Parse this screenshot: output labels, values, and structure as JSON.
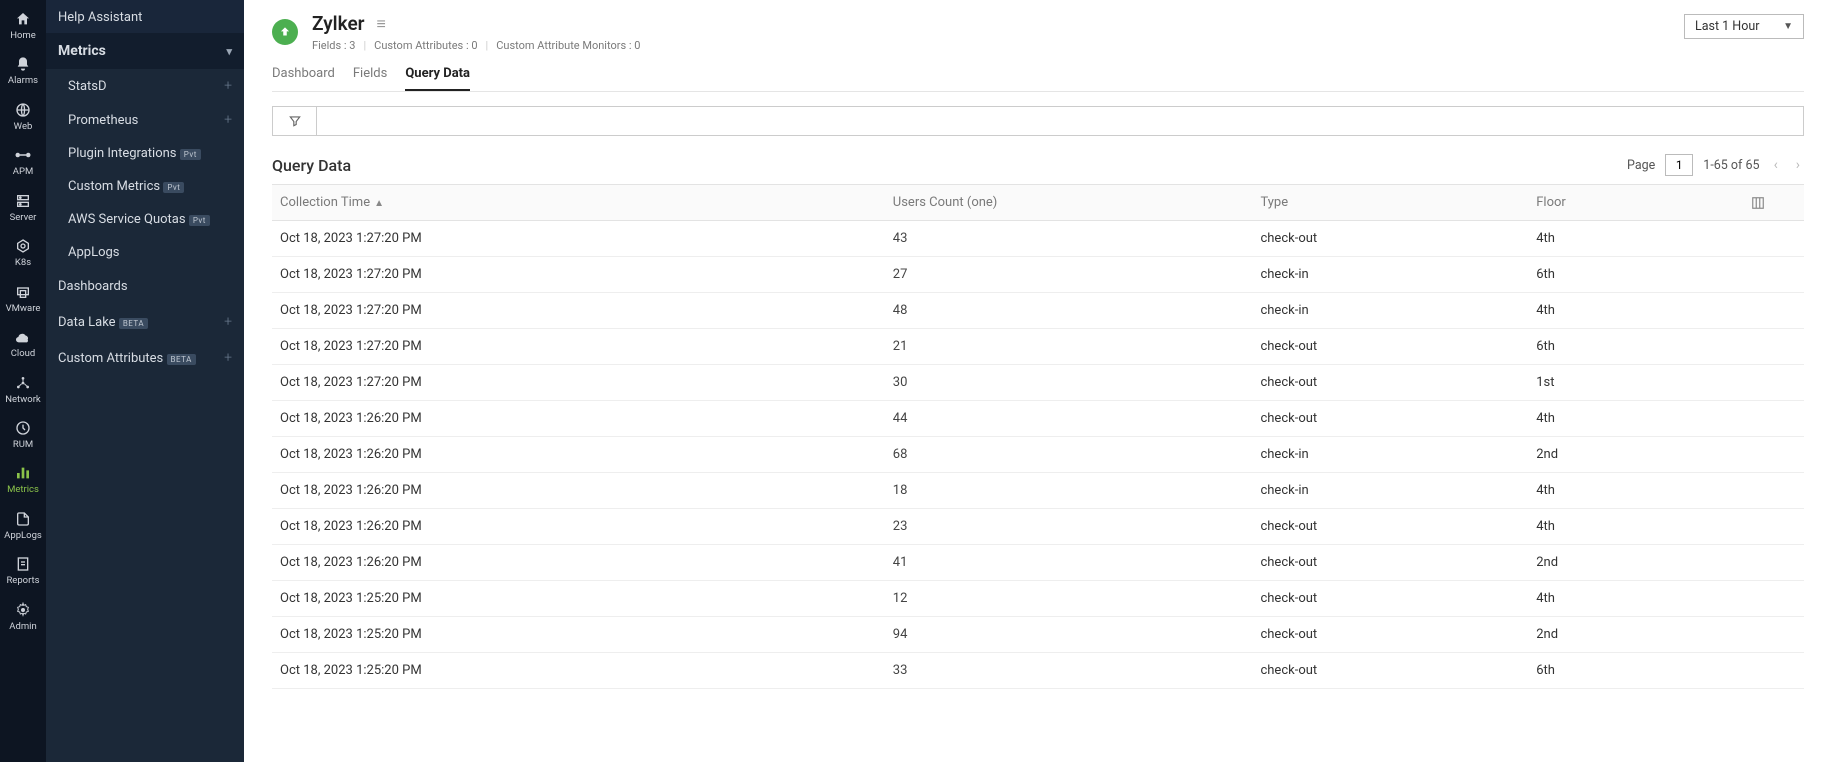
{
  "rail": [
    {
      "key": "home",
      "label": "Home"
    },
    {
      "key": "alarms",
      "label": "Alarms"
    },
    {
      "key": "web",
      "label": "Web"
    },
    {
      "key": "apm",
      "label": "APM"
    },
    {
      "key": "server",
      "label": "Server"
    },
    {
      "key": "k8s",
      "label": "K8s"
    },
    {
      "key": "vmware",
      "label": "VMware"
    },
    {
      "key": "cloud",
      "label": "Cloud"
    },
    {
      "key": "network",
      "label": "Network"
    },
    {
      "key": "rum",
      "label": "RUM"
    },
    {
      "key": "metrics",
      "label": "Metrics",
      "active": true
    },
    {
      "key": "applogs",
      "label": "AppLogs"
    },
    {
      "key": "reports",
      "label": "Reports"
    },
    {
      "key": "admin",
      "label": "Admin"
    }
  ],
  "sidebar": {
    "help": "Help Assistant",
    "section": "Metrics",
    "sub": [
      {
        "label": "StatsD",
        "plus": true
      },
      {
        "label": "Prometheus",
        "plus": true
      },
      {
        "label": "Plugin Integrations",
        "badge": "Pvt"
      },
      {
        "label": "Custom Metrics",
        "badge": "Pvt"
      },
      {
        "label": "AWS Service Quotas",
        "badge": "Pvt"
      },
      {
        "label": "AppLogs"
      }
    ],
    "items": [
      {
        "label": "Dashboards"
      },
      {
        "label": "Data Lake",
        "badge": "BETA",
        "plus": true
      },
      {
        "label": "Custom Attributes",
        "badge": "BETA",
        "plus": true
      }
    ]
  },
  "header": {
    "title": "Zylker",
    "fields_label": "Fields :",
    "fields_value": "3",
    "ca_label": "Custom Attributes :",
    "ca_value": "0",
    "cam_label": "Custom Attribute Monitors :",
    "cam_value": "0",
    "time_range": "Last 1 Hour"
  },
  "tabs": [
    {
      "label": "Dashboard"
    },
    {
      "label": "Fields"
    },
    {
      "label": "Query Data",
      "active": true
    }
  ],
  "search_placeholder": "",
  "section_title": "Query Data",
  "pager": {
    "page_label": "Page",
    "page": "1",
    "range": "1-65 of 65"
  },
  "columns": {
    "collection_time": "Collection Time",
    "users_count": "Users Count (one)",
    "type": "Type",
    "floor": "Floor"
  },
  "rows": [
    {
      "ct": "Oct 18, 2023 1:27:20 PM",
      "uc": "43",
      "ty": "check-out",
      "fl": "4th"
    },
    {
      "ct": "Oct 18, 2023 1:27:20 PM",
      "uc": "27",
      "ty": "check-in",
      "fl": "6th"
    },
    {
      "ct": "Oct 18, 2023 1:27:20 PM",
      "uc": "48",
      "ty": "check-in",
      "fl": "4th"
    },
    {
      "ct": "Oct 18, 2023 1:27:20 PM",
      "uc": "21",
      "ty": "check-out",
      "fl": "6th"
    },
    {
      "ct": "Oct 18, 2023 1:27:20 PM",
      "uc": "30",
      "ty": "check-out",
      "fl": "1st"
    },
    {
      "ct": "Oct 18, 2023 1:26:20 PM",
      "uc": "44",
      "ty": "check-out",
      "fl": "4th"
    },
    {
      "ct": "Oct 18, 2023 1:26:20 PM",
      "uc": "68",
      "ty": "check-in",
      "fl": "2nd"
    },
    {
      "ct": "Oct 18, 2023 1:26:20 PM",
      "uc": "18",
      "ty": "check-in",
      "fl": "4th"
    },
    {
      "ct": "Oct 18, 2023 1:26:20 PM",
      "uc": "23",
      "ty": "check-out",
      "fl": "4th"
    },
    {
      "ct": "Oct 18, 2023 1:26:20 PM",
      "uc": "41",
      "ty": "check-out",
      "fl": "2nd"
    },
    {
      "ct": "Oct 18, 2023 1:25:20 PM",
      "uc": "12",
      "ty": "check-out",
      "fl": "4th"
    },
    {
      "ct": "Oct 18, 2023 1:25:20 PM",
      "uc": "94",
      "ty": "check-out",
      "fl": "2nd"
    },
    {
      "ct": "Oct 18, 2023 1:25:20 PM",
      "uc": "33",
      "ty": "check-out",
      "fl": "6th"
    }
  ]
}
